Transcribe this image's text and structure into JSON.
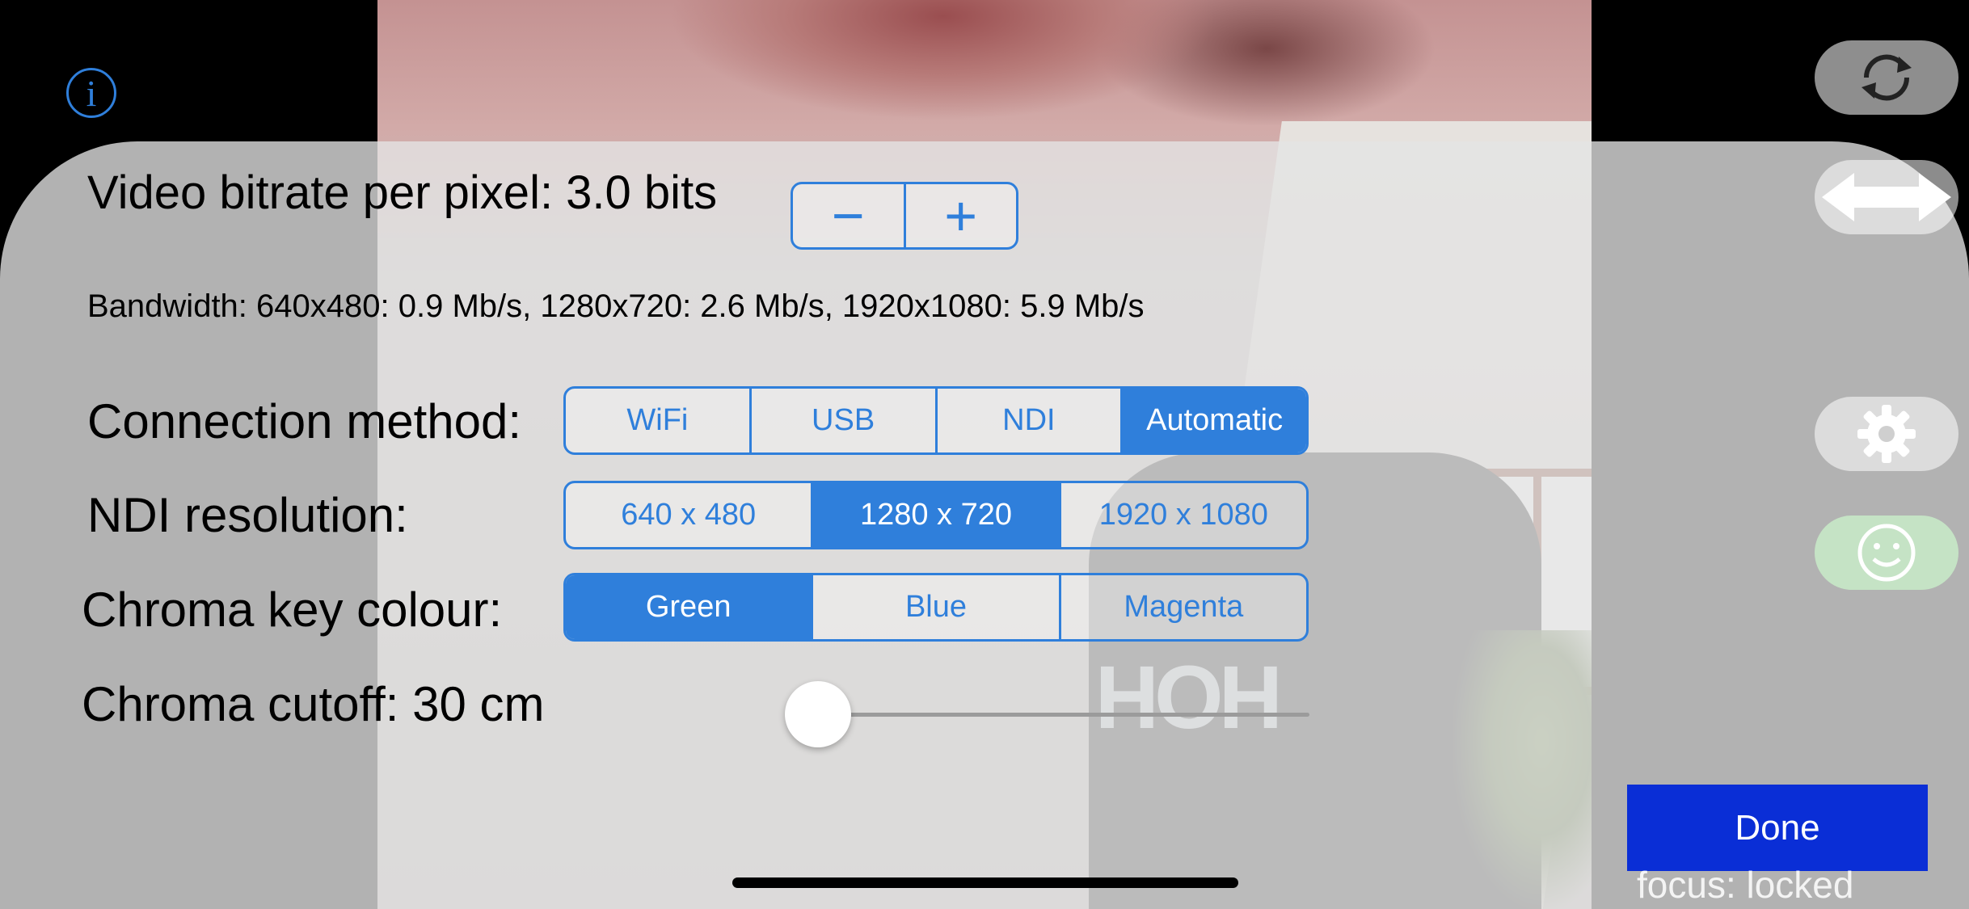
{
  "info": {
    "icon": "info-icon",
    "glyph": "i"
  },
  "settings": {
    "bitrate": {
      "label": "Video bitrate per pixel: 3.0 bits",
      "decrement": "−",
      "increment": "+"
    },
    "bandwidth_text": "Bandwidth: 640x480: 0.9 Mb/s, 1280x720: 2.6 Mb/s, 1920x1080: 5.9 Mb/s",
    "connection_method": {
      "label": "Connection method:",
      "options": [
        "WiFi",
        "USB",
        "NDI",
        "Automatic"
      ],
      "selected": "Automatic"
    },
    "ndi_resolution": {
      "label": "NDI resolution:",
      "options": [
        "640 x 480",
        "1280 x 720",
        "1920 x 1080"
      ],
      "selected": "1280 x 720"
    },
    "chroma_key_colour": {
      "label": "Chroma key colour:",
      "options": [
        "Green",
        "Blue",
        "Magenta"
      ],
      "selected": "Green"
    },
    "chroma_cutoff": {
      "label": "Chroma cutoff: 30 cm",
      "slider_fraction": 0.0
    }
  },
  "side_controls": {
    "rotate_icon": "camera-rotate-icon",
    "swap_icon": "swap-horizontal-icon",
    "settings_icon": "gear-icon",
    "face_icon": "face-tracking-icon"
  },
  "done_label": "Done",
  "focus_status": "focus: locked",
  "colors": {
    "accent": "#2f7fdb",
    "done_button": "#0a2ed6"
  }
}
